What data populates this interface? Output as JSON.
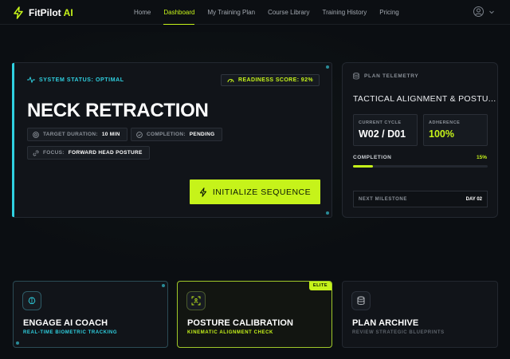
{
  "brand": {
    "name": "FitPilot",
    "accent": "AI"
  },
  "nav": {
    "links": [
      {
        "label": "Home"
      },
      {
        "label": "Dashboard"
      },
      {
        "label": "My Training Plan"
      },
      {
        "label": "Course Library"
      },
      {
        "label": "Training History"
      },
      {
        "label": "Pricing"
      }
    ],
    "active": "Dashboard"
  },
  "hero": {
    "status": "SYSTEM STATUS: OPTIMAL",
    "readiness": "READINESS SCORE: 92%",
    "title": "NECK RETRACTION",
    "chips": {
      "duration_key": "TARGET DURATION:",
      "duration_val": "10 MIN",
      "completion_key": "COMPLETION:",
      "completion_val": "PENDING",
      "focus_key": "FOCUS:",
      "focus_val": "FORWARD HEAD POSTURE"
    },
    "cta": "INITIALIZE SEQUENCE"
  },
  "telemetry": {
    "header": "PLAN TELEMETRY",
    "title": "TACTICAL ALIGNMENT & POSTU...",
    "cycle_label": "CURRENT CYCLE",
    "cycle_value": "W02 / D01",
    "adherence_label": "ADHERENCE",
    "adherence_value": "100%",
    "completion_label": "COMPLETION",
    "completion_value": "15%",
    "completion_fraction": 0.15,
    "milestone_label": "NEXT MILESTONE",
    "milestone_value": "DAY 02"
  },
  "cards": {
    "coach": {
      "title": "ENGAGE AI COACH",
      "subtitle": "REAL-TIME BIOMETRIC TRACKING"
    },
    "posture": {
      "title": "POSTURE CALIBRATION",
      "subtitle": "KINEMATIC ALIGNMENT CHECK",
      "badge": "ELITE"
    },
    "archive": {
      "title": "PLAN ARCHIVE",
      "subtitle": "REVIEW STRATEGIC BLUEPRINTS"
    }
  },
  "colors": {
    "accent": "#c6f31a",
    "cyan": "#2fd0e0",
    "background": "#0b0e12",
    "card": "#111419"
  },
  "icons": [
    "bolt-icon",
    "user-icon",
    "chevron-down-icon",
    "pulse-icon",
    "gauge-icon",
    "clock-icon",
    "check-circle-icon",
    "link-icon",
    "database-icon",
    "brain-icon",
    "scan-icon"
  ]
}
